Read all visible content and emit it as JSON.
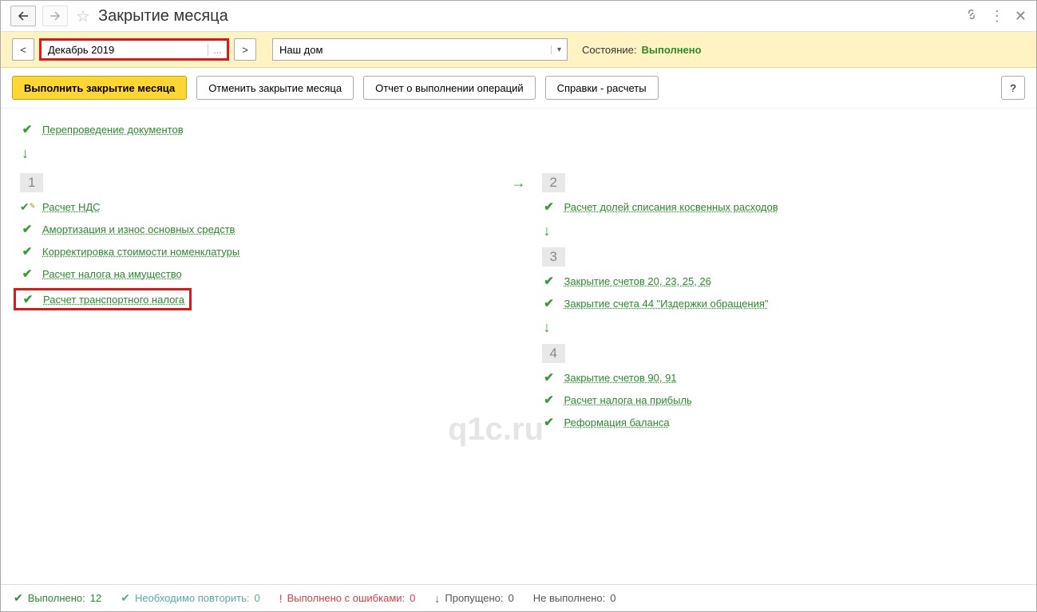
{
  "title": "Закрытие месяца",
  "filter": {
    "prev": "<",
    "next": ">",
    "period": "Декабрь 2019",
    "ellipsis": "...",
    "org": "Наш дом",
    "status_label": "Состояние:",
    "status_value": "Выполнено"
  },
  "actions": {
    "execute": "Выполнить закрытие месяца",
    "cancel": "Отменить закрытие месяца",
    "report": "Отчет о выполнении операций",
    "references": "Справки - расчеты",
    "help": "?"
  },
  "pre_op": "Перепроведение документов",
  "stages": {
    "s1": {
      "num": "1",
      "items": [
        "Расчет НДС",
        "Амортизация и износ основных средств",
        "Корректировка стоимости номенклатуры",
        "Расчет налога на имущество",
        "Расчет транспортного налога"
      ]
    },
    "s2": {
      "num": "2",
      "items": [
        "Расчет долей списания косвенных расходов"
      ]
    },
    "s3": {
      "num": "3",
      "items": [
        "Закрытие счетов 20, 23, 25, 26",
        "Закрытие счета 44 \"Издержки обращения\""
      ]
    },
    "s4": {
      "num": "4",
      "items": [
        "Закрытие счетов 90, 91",
        "Расчет налога на прибыль",
        "Реформация баланса"
      ]
    }
  },
  "statusbar": {
    "done_label": "Выполнено:",
    "done_count": "12",
    "repeat_label": "Необходимо повторить:",
    "repeat_count": "0",
    "errors_label": "Выполнено с ошибками:",
    "errors_count": "0",
    "skipped_label": "Пропущено:",
    "skipped_count": "0",
    "notdone_label": "Не выполнено:",
    "notdone_count": "0"
  },
  "watermark": "q1c.ru"
}
